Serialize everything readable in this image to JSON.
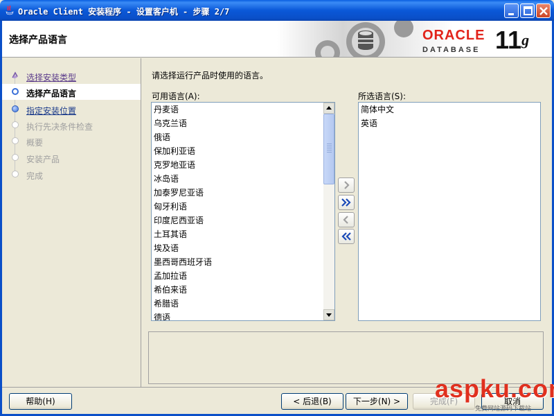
{
  "window": {
    "title": "Oracle Client 安装程序 - 设置客户机 - 步骤 2/7",
    "icons": [
      "java-app-icon",
      "minimize-icon",
      "maximize-icon",
      "close-icon"
    ]
  },
  "header": {
    "title": "选择产品语言",
    "brand": {
      "oracle": "ORACLE",
      "database": "DATABASE",
      "version": "11",
      "version_sup": "g"
    }
  },
  "nav": {
    "items": [
      {
        "label": "选择安装类型",
        "state": "done"
      },
      {
        "label": "选择产品语言",
        "state": "current"
      },
      {
        "label": "指定安装位置",
        "state": "link"
      },
      {
        "label": "执行先决条件检查",
        "state": "disabled"
      },
      {
        "label": "概要",
        "state": "disabled"
      },
      {
        "label": "安装产品",
        "state": "disabled"
      },
      {
        "label": "完成",
        "state": "disabled"
      }
    ]
  },
  "main": {
    "instruction": "请选择运行产品时使用的语言。",
    "available_label": "可用语言(A):",
    "selected_label": "所选语言(S):",
    "available": [
      "丹麦语",
      "乌克兰语",
      "俄语",
      "保加利亚语",
      "克罗地亚语",
      "冰岛语",
      "加泰罗尼亚语",
      "匈牙利语",
      "印度尼西亚语",
      "土耳其语",
      "埃及语",
      "墨西哥西班牙语",
      "孟加拉语",
      "希伯来语",
      "希腊语",
      "德语"
    ],
    "selected": [
      "简体中文",
      "英语"
    ]
  },
  "footer": {
    "help": "帮助(H)",
    "back": "< 后退(B)",
    "next": "下一步(N) >",
    "finish": "完成(F)",
    "cancel": "取消"
  },
  "watermark": {
    "text": "aspku.com",
    "sub": "免费网站源码下载站"
  },
  "colors": {
    "titlebar": "#0a5fe0",
    "oracle_red": "#e2231a",
    "link": "#1a3a8a"
  }
}
